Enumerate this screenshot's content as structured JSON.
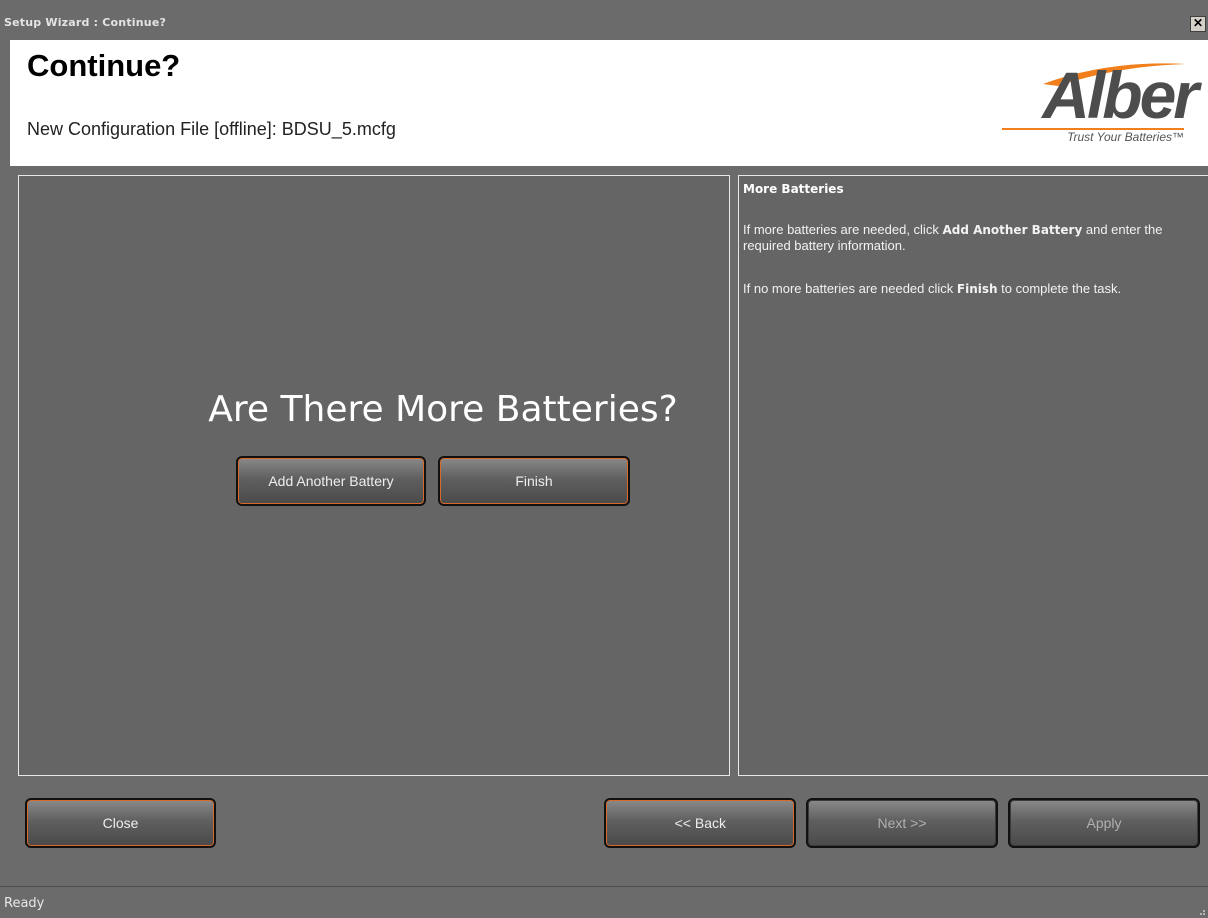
{
  "window": {
    "title": "Setup Wizard : Continue?",
    "close_glyph": "✕"
  },
  "header": {
    "title": "Continue?",
    "subtitle": "New Configuration File [offline]: BDSU_5.mcfg",
    "logo": {
      "brand": "Alber",
      "tagline": "Trust Your Batteries™",
      "accent_color": "#f07f1c"
    }
  },
  "main": {
    "question": "Are There More Batteries?",
    "add_button_label": "Add Another Battery",
    "finish_button_label": "Finish"
  },
  "help": {
    "title": "More Batteries",
    "p1_before": "If more batteries are needed, click ",
    "p1_bold": "Add Another Battery",
    "p1_after": " and enter the required battery information.",
    "p2_before": "If no more batteries are needed click ",
    "p2_bold": "Finish",
    "p2_after": " to complete the task."
  },
  "footer": {
    "close_label": "Close",
    "back_label": "<< Back",
    "next_label": "Next >>",
    "apply_label": "Apply"
  },
  "status": {
    "text": "Ready"
  }
}
